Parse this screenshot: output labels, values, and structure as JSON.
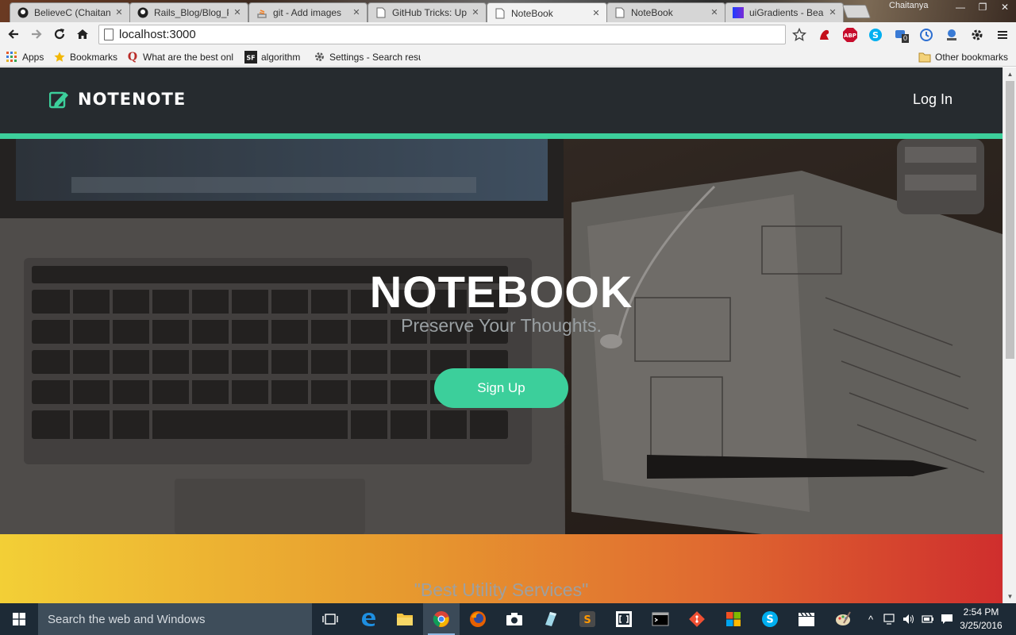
{
  "browser": {
    "tabs": [
      {
        "title": "BelieveC (Chaitanya",
        "icon": "github-icon",
        "active": false
      },
      {
        "title": "Rails_Blog/Blog_P",
        "icon": "github-icon",
        "active": false
      },
      {
        "title": "git - Add images",
        "icon": "stackoverflow-icon",
        "active": false
      },
      {
        "title": "GitHub Tricks: Up",
        "icon": "page-icon",
        "active": false
      },
      {
        "title": "NoteBook",
        "icon": "page-icon",
        "active": true
      },
      {
        "title": "NoteBook",
        "icon": "page-icon",
        "active": false
      },
      {
        "title": "uiGradients - Bea",
        "icon": "uigradients-icon",
        "active": false
      }
    ],
    "profile_name": "Chaitanya",
    "url": "localhost:3000",
    "bookmarks": [
      {
        "label": "Apps",
        "icon": "apps-grid-icon"
      },
      {
        "label": "Bookmarks",
        "icon": "star-icon"
      },
      {
        "label": "What are the best onl",
        "icon": "quora-icon"
      },
      {
        "label": "algorithm",
        "icon": "sf-icon"
      },
      {
        "label": "Settings - Search resu",
        "icon": "gear-icon"
      }
    ],
    "other_bookmarks": "Other bookmarks",
    "extension_badge": "0"
  },
  "site": {
    "brand": "NOTENOTE",
    "login_label": "Log In",
    "hero": {
      "title": "NOTEBOOK",
      "subtitle": "Preserve Your Thoughts.",
      "cta_label": "Sign Up"
    },
    "services_heading": "\"Best Utility Services\""
  },
  "taskbar": {
    "search_placeholder": "Search the web and Windows",
    "time": "2:54 PM",
    "date": "3/25/2016"
  },
  "colors": {
    "accent": "#3ccf9b",
    "nav_bg": "#262b2f",
    "gradient_start": "#f3cf36",
    "gradient_end": "#cf2e2d"
  }
}
